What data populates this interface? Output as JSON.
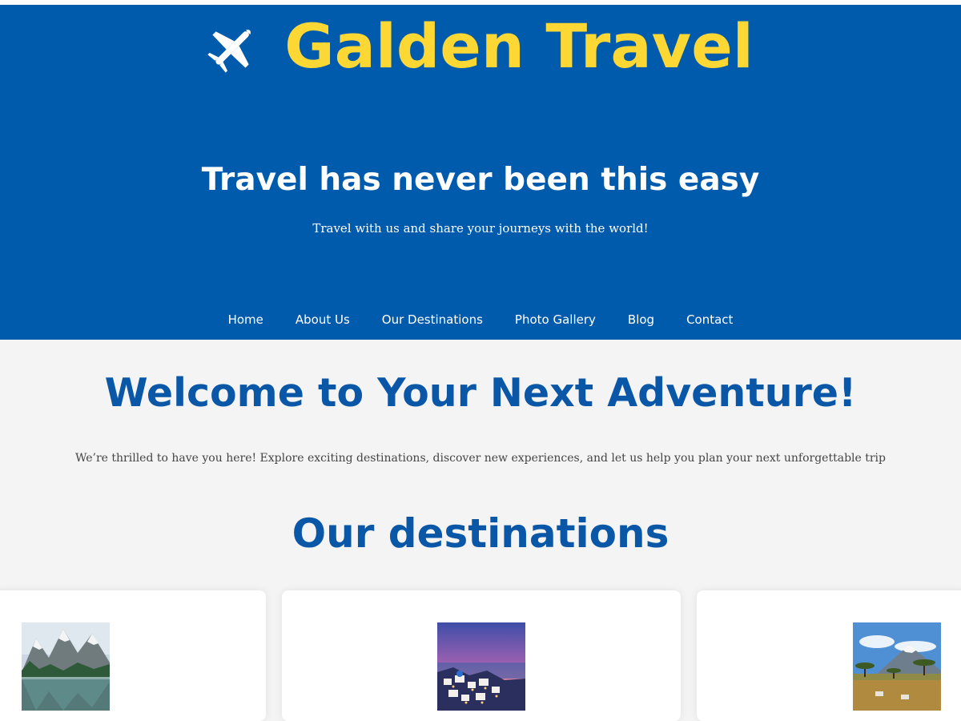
{
  "brand": {
    "name": "Galden Travel",
    "icon": "airplane-icon"
  },
  "hero": {
    "tagline": "Travel has never been this easy",
    "subtagline": "Travel with us and share your journeys with the world!"
  },
  "nav": {
    "items": [
      "Home",
      "About Us",
      "Our Destinations",
      "Photo Gallery",
      "Blog",
      "Contact"
    ]
  },
  "main": {
    "welcome_title": "Welcome to Your Next Adventure!",
    "intro_text": "We’re thrilled to have you here! Explore exciting destinations, discover new experiences, and let us help you plan your next unforgettable trip",
    "destinations_title": "Our destinations"
  },
  "destinations": [
    {
      "image": "mountain-lake-photo"
    },
    {
      "image": "santorini-sunset-photo"
    },
    {
      "image": "kilimanjaro-savanna-photo"
    }
  ],
  "colors": {
    "hero_background": "#005bac",
    "brand_yellow": "#fdd835",
    "heading_blue": "#0a57a8",
    "page_background": "#f4f4f4"
  }
}
